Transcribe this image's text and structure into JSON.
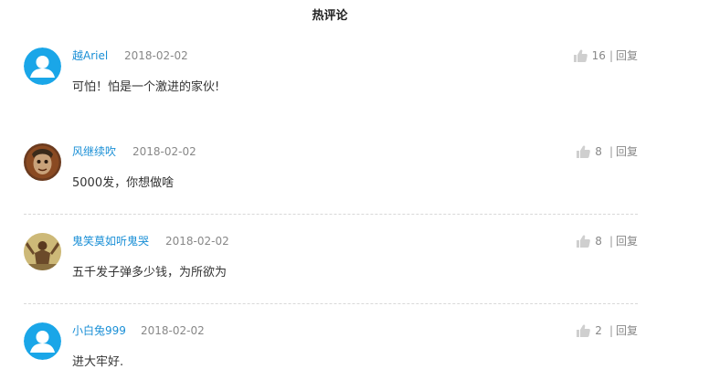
{
  "section_title": "热评论",
  "colors": {
    "username": "#1a8fd6",
    "default_avatar_bg": "#1aa6e8"
  },
  "comments": [
    {
      "username": "越Ariel",
      "date": "2018-02-02",
      "likes": "16",
      "separator": "|",
      "reply_label": "回复",
      "content": "可怕！怕是一个激进的家伙!",
      "avatar": "default-user-icon"
    },
    {
      "username": "风继续吹",
      "date": "2018-02-02",
      "likes": "8",
      "separator": "|",
      "reply_label": "回复",
      "content": "5000发，你想做啥",
      "avatar": "user-photo"
    },
    {
      "username": "鬼笑莫如听鬼哭",
      "date": "2018-02-02",
      "likes": "8",
      "separator": "|",
      "reply_label": "回复",
      "content": "五千发子弹多少钱，为所欲为",
      "avatar": "user-photo"
    },
    {
      "username": "小白兔999",
      "date": "2018-02-02",
      "likes": "2",
      "separator": "|",
      "reply_label": "回复",
      "content": "进大牢好.",
      "avatar": "default-user-icon"
    }
  ]
}
